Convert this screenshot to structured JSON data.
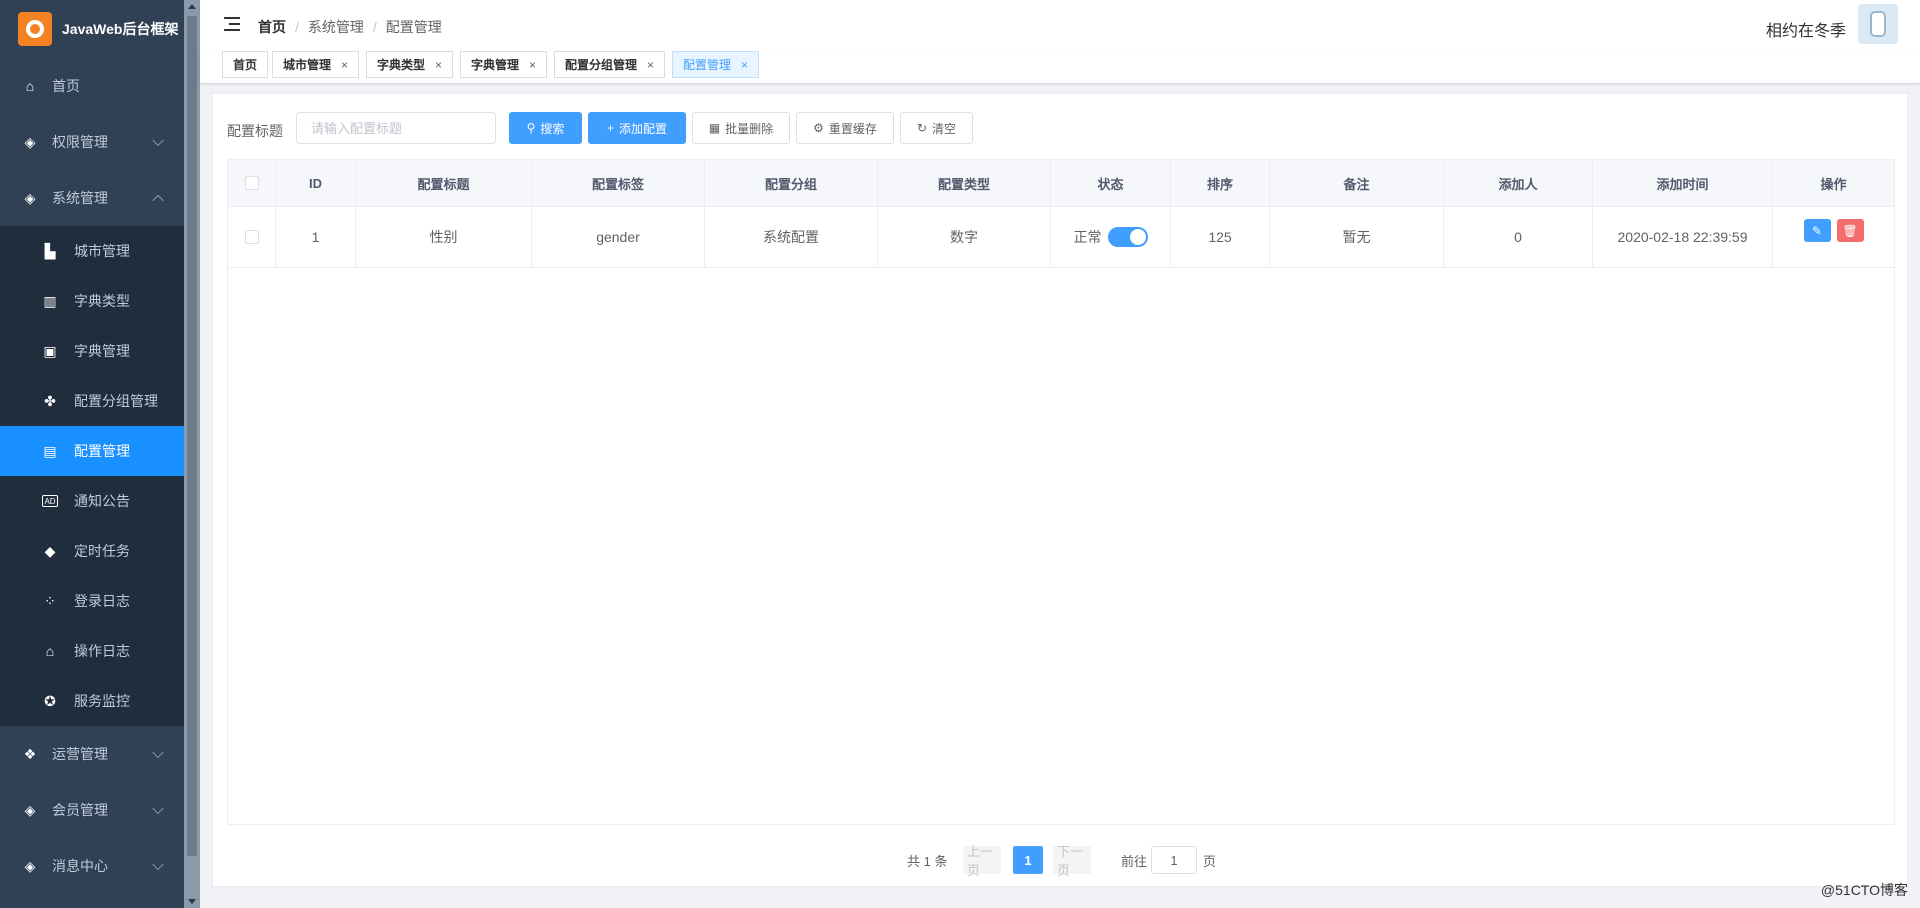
{
  "app": {
    "title": "JavaWeb后台框架"
  },
  "sidebar": {
    "items": [
      {
        "label": "首页"
      },
      {
        "label": "权限管理"
      },
      {
        "label": "系统管理"
      },
      {
        "label": "城市管理"
      },
      {
        "label": "字典类型"
      },
      {
        "label": "字典管理"
      },
      {
        "label": "配置分组管理"
      },
      {
        "label": "配置管理"
      },
      {
        "label": "通知公告"
      },
      {
        "label": "定时任务"
      },
      {
        "label": "登录日志"
      },
      {
        "label": "操作日志"
      },
      {
        "label": "服务监控"
      },
      {
        "label": "运营管理"
      },
      {
        "label": "会员管理"
      },
      {
        "label": "消息中心"
      }
    ],
    "active_color": "#1890ff",
    "bg_color": "#304156"
  },
  "header": {
    "breadcrumb": [
      "首页",
      "系统管理",
      "配置管理"
    ],
    "separator": "/",
    "user_name": "相约在冬季"
  },
  "tags": [
    {
      "label": "首页"
    },
    {
      "label": "城市管理"
    },
    {
      "label": "字典类型"
    },
    {
      "label": "字典管理"
    },
    {
      "label": "配置分组管理"
    },
    {
      "label": "配置管理"
    }
  ],
  "filter": {
    "label": "配置标题",
    "placeholder": "请输入配置标题",
    "buttons": {
      "search": "搜索",
      "add": "添加配置",
      "batch_delete": "批量删除",
      "reset_cache": "重置缓存",
      "clear": "清空"
    }
  },
  "table": {
    "columns": [
      "ID",
      "配置标题",
      "配置标签",
      "配置分组",
      "配置类型",
      "状态",
      "排序",
      "备注",
      "添加人",
      "添加时间",
      "操作"
    ],
    "rows": [
      {
        "id": "1",
        "title": "性别",
        "tag": "gender",
        "group": "系统配置",
        "type": "数字",
        "status": "正常",
        "status_on": true,
        "sort": "125",
        "remark": "暂无",
        "creator": "0",
        "created_at": "2020-02-18 22:39:59"
      }
    ]
  },
  "pagination": {
    "total_text": "共 1 条",
    "prev": "上一页",
    "current": "1",
    "next": "下一页",
    "goto_prefix": "前往",
    "goto_value": "1",
    "goto_suffix": "页"
  },
  "watermark": "@51CTO博客",
  "colors": {
    "primary": "#409eff",
    "danger": "#f56c6c"
  }
}
